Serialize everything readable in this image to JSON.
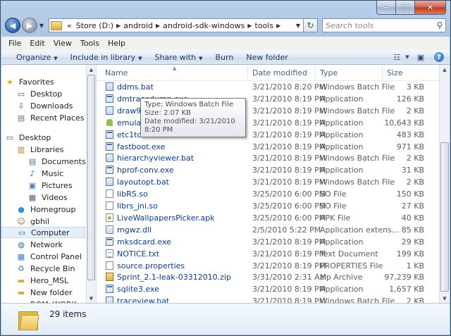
{
  "window": {
    "caption_buttons": {
      "minimize": "–",
      "maximize": "□",
      "close": "✕"
    }
  },
  "address": {
    "prefix": "«",
    "crumbs": [
      "Store (D:)",
      "android",
      "android-sdk-windows",
      "tools"
    ],
    "search_placeholder": "Search tools"
  },
  "menu": [
    {
      "label": "File"
    },
    {
      "label": "Edit"
    },
    {
      "label": "View"
    },
    {
      "label": "Tools"
    },
    {
      "label": "Help"
    }
  ],
  "toolbar": {
    "organize": "Organize",
    "include_in_library": "Include in library",
    "share_with": "Share with",
    "burn": "Burn",
    "new_folder": "New folder"
  },
  "nav": {
    "items": [
      {
        "label": "Favorites",
        "icon": "star-icon",
        "indent": 0
      },
      {
        "label": "Desktop",
        "icon": "desktop-icon",
        "indent": 1
      },
      {
        "label": "Downloads",
        "icon": "downloads-icon",
        "indent": 1
      },
      {
        "label": "Recent Places",
        "icon": "recent-places-icon",
        "indent": 1
      },
      {
        "label": "Desktop",
        "icon": "desktop-icon",
        "indent": 0
      },
      {
        "label": "Libraries",
        "icon": "libraries-icon",
        "indent": 1
      },
      {
        "label": "Documents",
        "icon": "documents-icon",
        "indent": 2
      },
      {
        "label": "Music",
        "icon": "music-icon",
        "indent": 2
      },
      {
        "label": "Pictures",
        "icon": "pictures-icon",
        "indent": 2
      },
      {
        "label": "Videos",
        "icon": "videos-icon",
        "indent": 2
      },
      {
        "label": "Homegroup",
        "icon": "homegroup-icon",
        "indent": 1
      },
      {
        "label": "gbhil",
        "icon": "user-icon",
        "indent": 1
      },
      {
        "label": "Computer",
        "icon": "computer-icon",
        "indent": 1,
        "selected": true
      },
      {
        "label": "Network",
        "icon": "network-icon",
        "indent": 1
      },
      {
        "label": "Control Panel",
        "icon": "control-panel-icon",
        "indent": 1
      },
      {
        "label": "Recycle Bin",
        "icon": "recycle-bin-icon",
        "indent": 1
      },
      {
        "label": "Hero_MSL",
        "icon": "folder-icon",
        "indent": 1
      },
      {
        "label": "New folder",
        "icon": "folder-icon",
        "indent": 1
      },
      {
        "label": "ROM_WORK",
        "icon": "folder-icon",
        "indent": 1
      }
    ]
  },
  "columns": {
    "name": "Name",
    "date": "Date modified",
    "type": "Type",
    "size": "Size"
  },
  "files": [
    {
      "name": "ddms.bat",
      "date": "3/21/2010 8:20 PM",
      "type": "Windows Batch File",
      "size": "3 KB",
      "kind": "bat"
    },
    {
      "name": "dmtracedump.exe",
      "date": "3/21/2010 8:19 PM",
      "type": "Application",
      "size": "126 KB",
      "kind": "exe"
    },
    {
      "name": "draw9patch.bat",
      "date": "3/21/2010 8:19 PM",
      "type": "Windows Batch File",
      "size": "2 KB",
      "kind": "bat"
    },
    {
      "name": "emulator.exe",
      "date": "3/21/2010 8:19 PM",
      "type": "Application",
      "size": "10,643 KB",
      "kind": "android"
    },
    {
      "name": "etc1tool.exe",
      "date": "3/21/2010 8:19 PM",
      "type": "Application",
      "size": "483 KB",
      "kind": "exe"
    },
    {
      "name": "fastboot.exe",
      "date": "3/21/2010 8:19 PM",
      "type": "Application",
      "size": "971 KB",
      "kind": "exe"
    },
    {
      "name": "hierarchyviewer.bat",
      "date": "3/21/2010 8:19 PM",
      "type": "Windows Batch File",
      "size": "2 KB",
      "kind": "bat"
    },
    {
      "name": "hprof-conv.exe",
      "date": "3/21/2010 8:19 PM",
      "type": "Application",
      "size": "31 KB",
      "kind": "exe"
    },
    {
      "name": "layoutopt.bat",
      "date": "3/21/2010 8:19 PM",
      "type": "Windows Batch File",
      "size": "2 KB",
      "kind": "bat"
    },
    {
      "name": "libRS.so",
      "date": "3/25/2010 6:00 PM",
      "type": "SO File",
      "size": "150 KB",
      "kind": "so"
    },
    {
      "name": "librs_jni.so",
      "date": "3/25/2010 6:00 PM",
      "type": "SO File",
      "size": "27 KB",
      "kind": "so"
    },
    {
      "name": "LiveWallpapersPicker.apk",
      "date": "3/25/2010 6:00 PM",
      "type": "APK File",
      "size": "40 KB",
      "kind": "apk"
    },
    {
      "name": "mgwz.dll",
      "date": "2/5/2010 5:22 PM",
      "type": "Application extens...",
      "size": "85 KB",
      "kind": "dll"
    },
    {
      "name": "mksdcard.exe",
      "date": "3/21/2010 8:19 PM",
      "type": "Application",
      "size": "29 KB",
      "kind": "exe"
    },
    {
      "name": "NOTICE.txt",
      "date": "3/21/2010 8:19 PM",
      "type": "Text Document",
      "size": "199 KB",
      "kind": "txt"
    },
    {
      "name": "source.properties",
      "date": "3/21/2010 8:19 PM",
      "type": "PROPERTIES File",
      "size": "1 KB",
      "kind": "so"
    },
    {
      "name": "Sprint_2.1-leak-03312010.zip",
      "date": "3/31/2010 2:31 AM",
      "type": "zip Archive",
      "size": "97,239 KB",
      "kind": "zip"
    },
    {
      "name": "sqlite3.exe",
      "date": "3/21/2010 8:19 PM",
      "type": "Application",
      "size": "1,657 KB",
      "kind": "exe"
    },
    {
      "name": "traceview.bat",
      "date": "3/21/2010 8:19 PM",
      "type": "Windows Batch File",
      "size": "2 KB",
      "kind": "bat"
    }
  ],
  "tooltip": {
    "type": "Type: Windows Batch File",
    "size": "Size: 2.07 KB",
    "date": "Date modified: 3/21/2010 8:20 PM"
  },
  "details": {
    "item_count": "29 items"
  }
}
